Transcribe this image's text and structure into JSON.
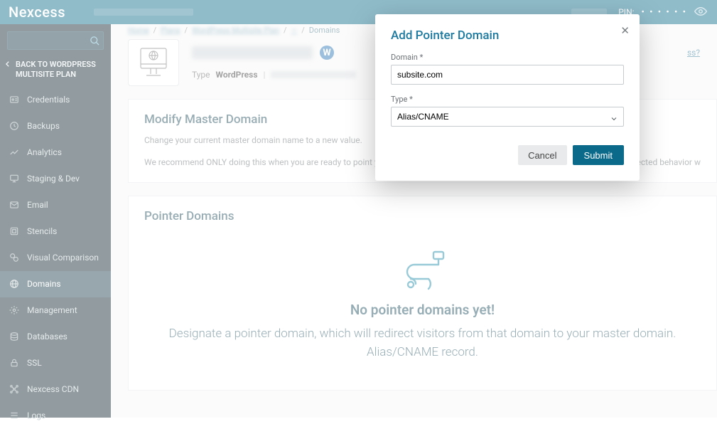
{
  "brand": "Nexcess",
  "topbar": {
    "pin_label": "PIN:",
    "pin_mask": "• • • • • •"
  },
  "sidebar": {
    "back_label": "BACK TO WORDPRESS MULTISITE PLAN",
    "items": [
      {
        "label": "Credentials",
        "icon": "id-card-icon"
      },
      {
        "label": "Backups",
        "icon": "clock-icon"
      },
      {
        "label": "Analytics",
        "icon": "chart-icon"
      },
      {
        "label": "Staging & Dev",
        "icon": "monitor-icon"
      },
      {
        "label": "Email",
        "icon": "mail-icon"
      },
      {
        "label": "Stencils",
        "icon": "stencil-icon"
      },
      {
        "label": "Visual Comparison",
        "icon": "compare-icon"
      },
      {
        "label": "Domains",
        "icon": "globe-icon",
        "active": true
      },
      {
        "label": "Management",
        "icon": "gear-icon"
      },
      {
        "label": "Databases",
        "icon": "database-icon"
      },
      {
        "label": "SSL",
        "icon": "lock-icon"
      },
      {
        "label": "Nexcess CDN",
        "icon": "cdn-icon"
      },
      {
        "label": "Logs",
        "icon": "logs-icon"
      }
    ]
  },
  "breadcrumbs": {
    "items": [
      "Home",
      "Plans",
      "WordPress Multisite Plan",
      "—",
      "Domains"
    ]
  },
  "header": {
    "type_label": "Type",
    "type_value": "WordPress",
    "help_suffix": "ss?"
  },
  "master_card": {
    "title": "Modify Master Domain",
    "line1": "Change your current master domain name to a new value.",
    "line2": "We recommend ONLY doing this when you are ready to point your DN",
    "line2_tail": "nexpected behavior w"
  },
  "pointer_card": {
    "title": "Pointer Domains",
    "empty_title": "No pointer domains yet!",
    "empty_line1": "Designate a pointer domain, which will redirect visitors from that domain to your master domain.",
    "empty_line2": "Alias/CNAME record."
  },
  "modal": {
    "title": "Add Pointer Domain",
    "domain_label": "Domain *",
    "domain_value": "subsite.com",
    "type_label": "Type *",
    "type_value": "Alias/CNAME",
    "cancel": "Cancel",
    "submit": "Submit"
  }
}
